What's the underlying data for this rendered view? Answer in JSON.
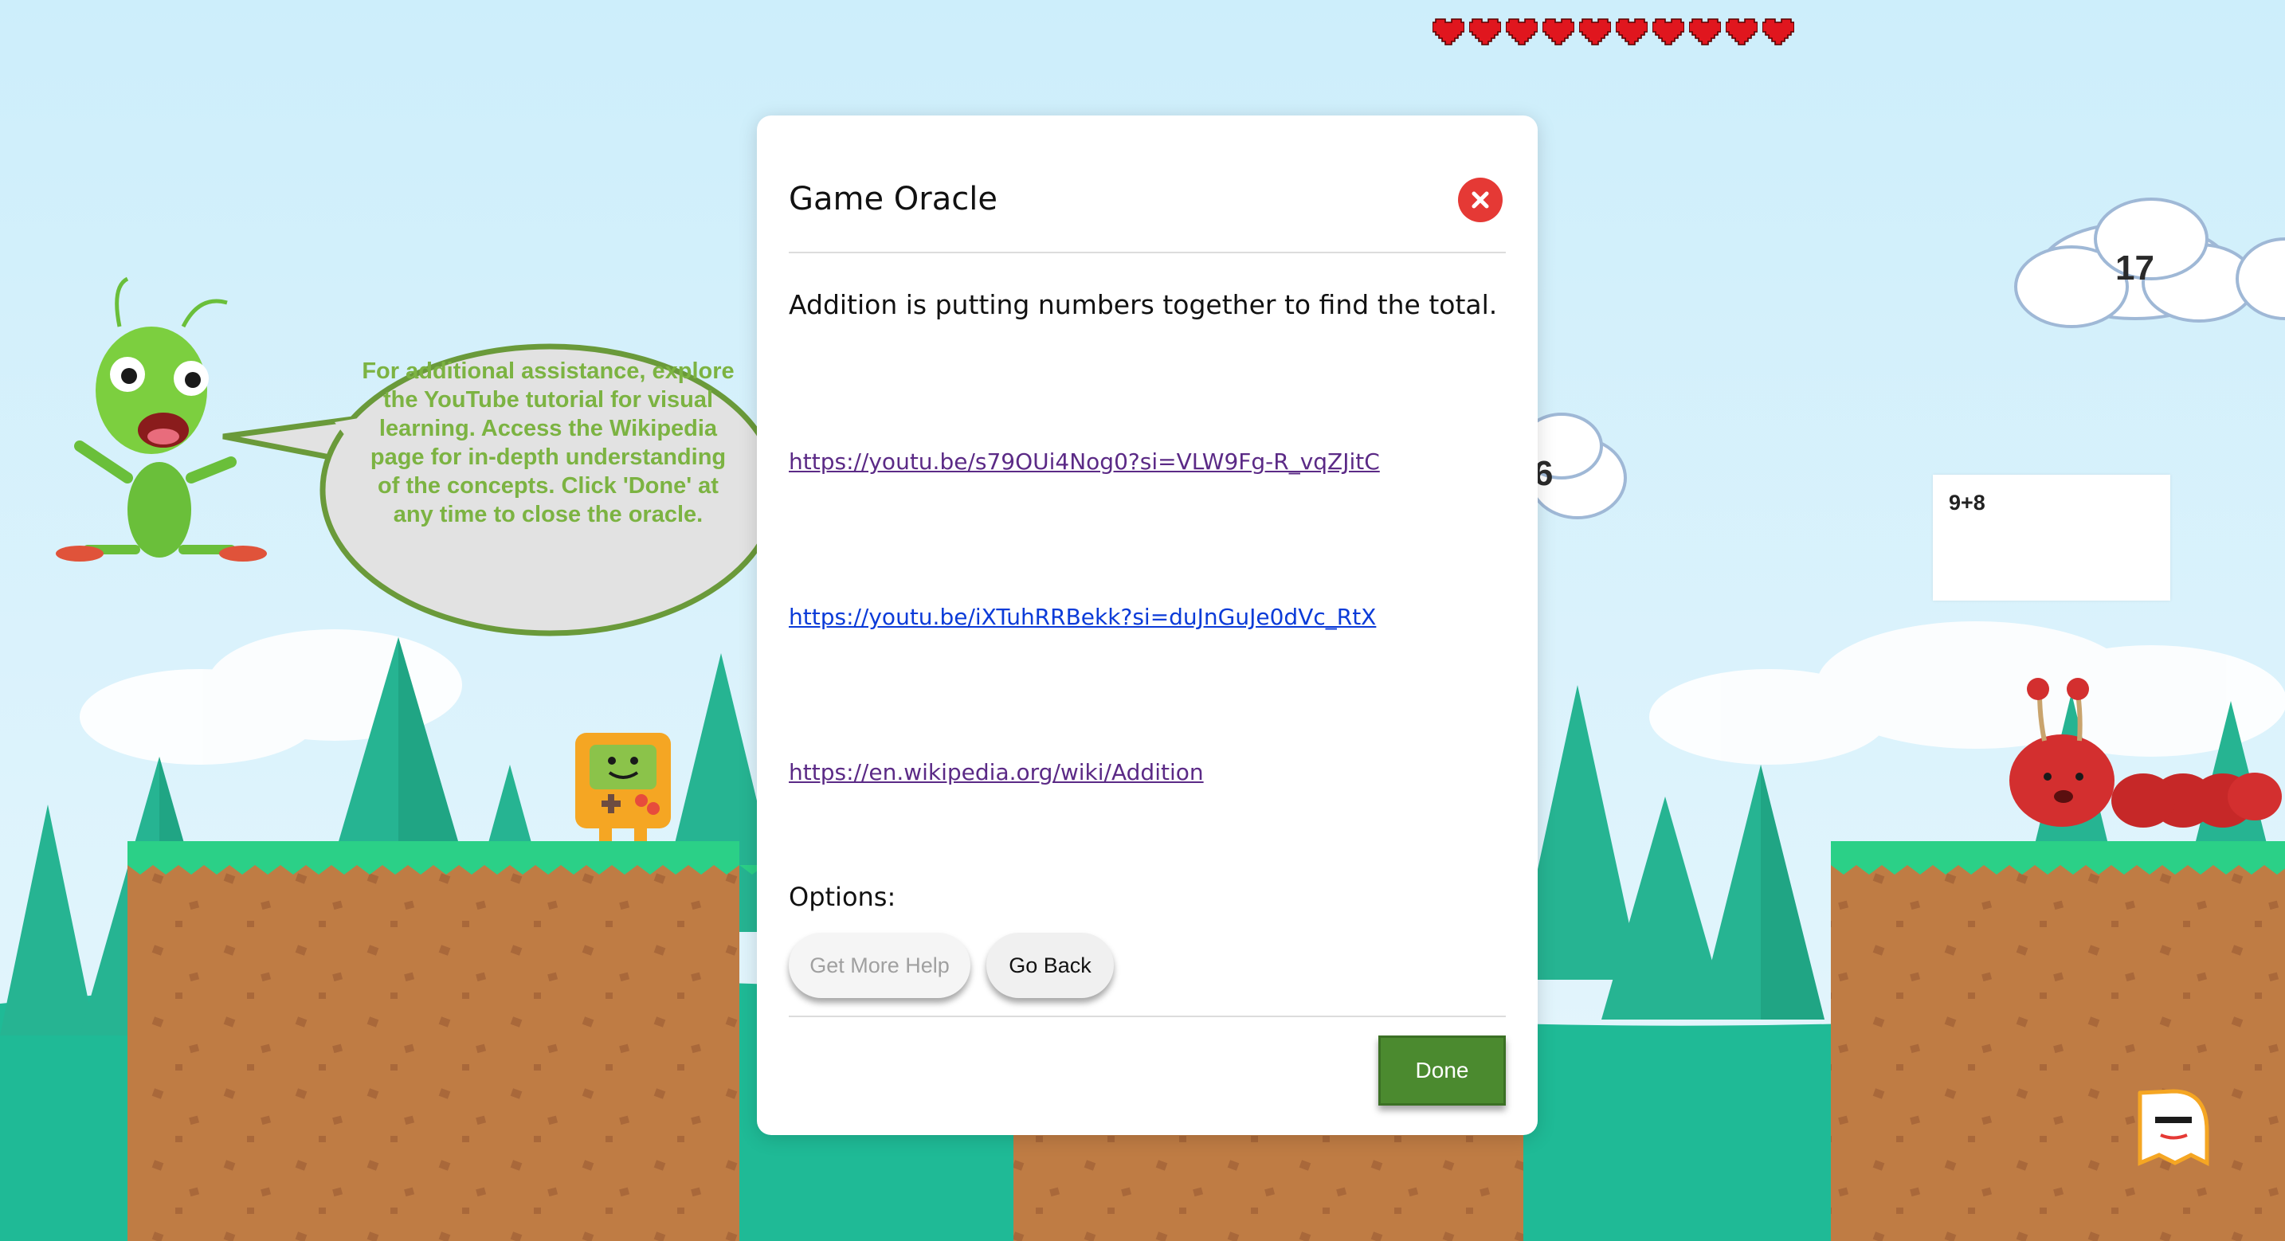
{
  "hud": {
    "lives": 10,
    "heart_color": "#e0161e"
  },
  "clouds": [
    {
      "number": "17"
    },
    {
      "number": "6"
    }
  ],
  "question": {
    "expression": "9+8"
  },
  "helper": {
    "speech": "For additional assistance, explore the YouTube tutorial for visual learning. Access the Wikipedia page for in-depth understanding of the concepts. Click 'Done' at any time to close the oracle.",
    "speech_color": "#7cb342"
  },
  "modal": {
    "title": "Game Oracle",
    "message": "Addition is putting numbers together to find the total.",
    "links": [
      {
        "text": "https://youtu.be/s79OUi4Nog0?si=VLW9Fg-R_vqZJitC",
        "visited": true
      },
      {
        "text": "https://youtu.be/iXTuhRRBekk?si=duJnGuJe0dVc_RtX",
        "visited": false
      },
      {
        "text": "https://en.wikipedia.org/wiki/Addition",
        "visited": true
      }
    ],
    "options_label": "Options:",
    "get_more_help_label": "Get More Help",
    "go_back_label": "Go Back",
    "done_label": "Done",
    "close_icon": "close-icon",
    "accent_color": "#4b8a2f",
    "close_color": "#e53935"
  }
}
